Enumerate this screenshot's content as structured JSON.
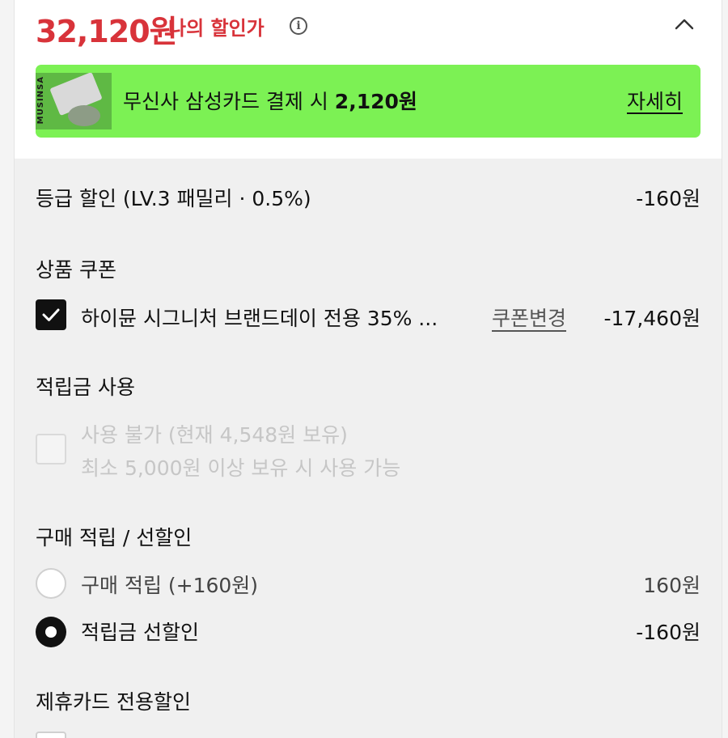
{
  "header": {
    "price": "32,120원",
    "price_label": "나의 할인가",
    "info_icon": "info-circle-icon",
    "collapse_icon": "chevron-up-icon"
  },
  "banner": {
    "thumb_text": "MUSINSA",
    "text_prefix": "무신사 삼성카드 결제 시",
    "amount": "2,120원",
    "link": "자세히",
    "color": "#7cf154"
  },
  "grade_discount": {
    "label": "등급 할인 (LV.3 패밀리 · 0.5%)",
    "amount": "-160원"
  },
  "product_coupon": {
    "title": "상품 쿠폰",
    "coupon_label": "하이뮨 시그니처 브랜드데이 전용 35% ...",
    "change_link": "쿠폰변경",
    "amount": "-17,460원",
    "checked": true
  },
  "points": {
    "title": "적립금 사용",
    "line1": "사용 불가 (현재 4,548원 보유)",
    "line2": "최소 5,000원 이상 보유 시 사용 가능",
    "enabled": false
  },
  "purchase_reward": {
    "title": "구매 적립 / 선할인",
    "options": [
      {
        "label": "구매 적립 (+160원)",
        "amount": "160원",
        "selected": false
      },
      {
        "label": "적립금 선할인",
        "amount": "-160원",
        "selected": true
      }
    ]
  },
  "card_discount": {
    "title": "제휴카드 전용할인"
  },
  "colors": {
    "price_red": "#d8333a",
    "disabled_gray": "#c6c6c6"
  }
}
